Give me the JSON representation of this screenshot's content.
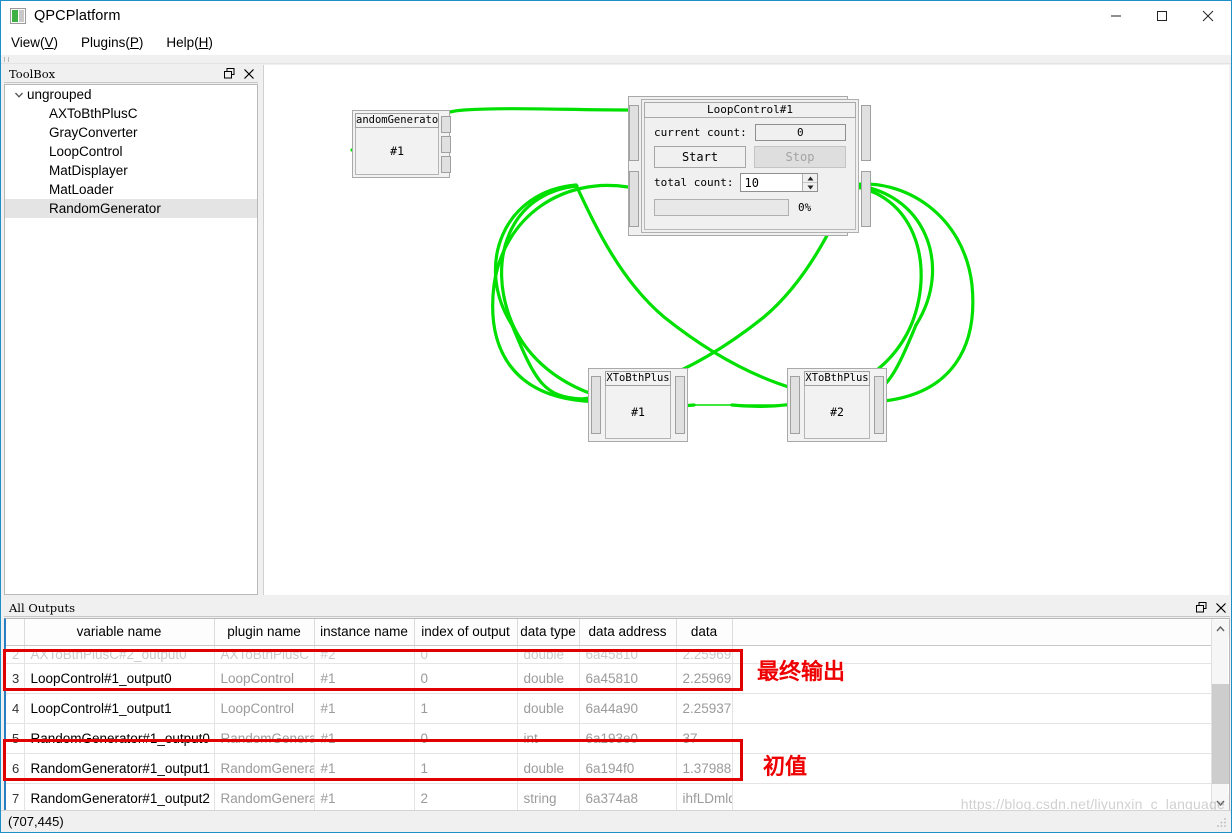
{
  "window": {
    "title": "QPCPlatform",
    "icon": "app-icon",
    "minimize_label": "─",
    "maximize_label": "□",
    "close_label": "✕"
  },
  "menubar": {
    "items": [
      {
        "label": "View",
        "accel": "V"
      },
      {
        "label": "Plugins",
        "accel": "P"
      },
      {
        "label": "Help",
        "accel": "H"
      }
    ]
  },
  "toolbox": {
    "title": "ToolBox",
    "float_label": "❐",
    "close_label": "✕",
    "root": {
      "label": "ungrouped",
      "expanded": true
    },
    "items": [
      {
        "label": "AXToBthPlusC",
        "selected": false
      },
      {
        "label": "GrayConverter",
        "selected": false
      },
      {
        "label": "LoopControl",
        "selected": false
      },
      {
        "label": "MatDisplayer",
        "selected": false
      },
      {
        "label": "MatLoader",
        "selected": false
      },
      {
        "label": "RandomGenerator",
        "selected": true
      }
    ]
  },
  "canvas": {
    "wire_color": "#00e000",
    "nodes": {
      "random_generator": {
        "caption": "andomGenerato",
        "instance": "#1",
        "output_port_count": 3
      },
      "loop_control": {
        "title": "LoopControl#1",
        "current_count_label": "current count:",
        "current_count_value": "0",
        "start_label": "Start",
        "stop_label": "Stop",
        "total_count_label": "total count:",
        "total_count_value": "10",
        "progress_text": "0%",
        "progress_percent": 0,
        "spin_up": "▲",
        "spin_dn": "▼"
      },
      "ax_node_1": {
        "caption": "XToBthPlus",
        "instance": "#1"
      },
      "ax_node_2": {
        "caption": "XToBthPlus",
        "instance": "#2"
      }
    }
  },
  "outputs": {
    "title": "All Outputs",
    "float_label": "❐",
    "close_label": "✕",
    "columns": [
      "",
      "variable name",
      "plugin name",
      "instance name",
      "index of output",
      "data type",
      "data address",
      "data",
      ""
    ],
    "rows": [
      {
        "index": "2",
        "variable_name": "AXToBthPlusC#2_output0",
        "plugin_name": "AXToBthPlusC",
        "instance_name": "#2",
        "index_of_output": "0",
        "data_type": "double",
        "data_address": "6a45810",
        "data": "2.25969",
        "clipped": true
      },
      {
        "index": "3",
        "variable_name": "LoopControl#1_output0",
        "plugin_name": "LoopControl",
        "instance_name": "#1",
        "index_of_output": "0",
        "data_type": "double",
        "data_address": "6a45810",
        "data": "2.25969",
        "clipped": false
      },
      {
        "index": "4",
        "variable_name": "LoopControl#1_output1",
        "plugin_name": "LoopControl",
        "instance_name": "#1",
        "index_of_output": "1",
        "data_type": "double",
        "data_address": "6a44a90",
        "data": "2.25937",
        "clipped": false
      },
      {
        "index": "5",
        "variable_name": "RandomGenerator#1_output0",
        "plugin_name": "RandomGenerator",
        "instance_name": "#1",
        "index_of_output": "0",
        "data_type": "int",
        "data_address": "6a193e0",
        "data": "37",
        "clipped": false
      },
      {
        "index": "6",
        "variable_name": "RandomGenerator#1_output1",
        "plugin_name": "RandomGenerator",
        "instance_name": "#1",
        "index_of_output": "1",
        "data_type": "double",
        "data_address": "6a194f0",
        "data": "1.37988",
        "clipped": false
      },
      {
        "index": "7",
        "variable_name": "RandomGenerator#1_output2",
        "plugin_name": "RandomGenerator",
        "instance_name": "#1",
        "index_of_output": "2",
        "data_type": "string",
        "data_address": "6a374a8",
        "data": "ihfLDmld",
        "clipped": false
      }
    ],
    "scroll_up": "▲",
    "scroll_down": "▼"
  },
  "annotations": [
    {
      "text": "最终输出",
      "color": "#ee0000"
    },
    {
      "text": "初值",
      "color": "#ee0000"
    }
  ],
  "statusbar": {
    "coordinates": "(707,445)"
  },
  "watermark": {
    "text": "https://blog.csdn.net/liyunxin_c_language"
  }
}
